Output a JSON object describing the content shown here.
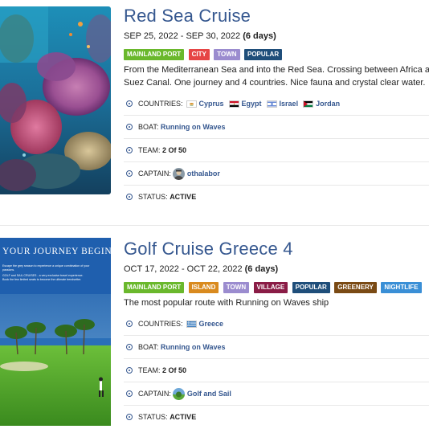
{
  "cruises": [
    {
      "title": "Red Sea Cruise",
      "dates": "SEP 25, 2022 - SEP 30, 2022",
      "duration": "(6 days)",
      "tags": [
        {
          "label": "MAINLAND PORT",
          "color": "#6ab82c"
        },
        {
          "label": "CITY",
          "color": "#e64545"
        },
        {
          "label": "TOWN",
          "color": "#9b8ccf"
        },
        {
          "label": "POPULAR",
          "color": "#1f4e7a"
        }
      ],
      "description_lines": [
        "From the Mediterranean Sea and into the Red Sea. Crossing between Africa and",
        "Suez Canal. One journey and 4 countries. Nice fauna and crystal clear water."
      ],
      "countries_label": "COUNTRIES:",
      "countries": [
        "Cyprus",
        "Egypt",
        "Israel",
        "Jordan"
      ],
      "boat_label": "BOAT:",
      "boat": "Running on Waves",
      "team_label": "TEAM:",
      "team": "2 Of 50",
      "captain_label": "CAPTAIN:",
      "captain": "othalabor",
      "status_label": "STATUS:",
      "status": "ACTIVE"
    },
    {
      "title": "Golf Cruise Greece 4",
      "dates": "OCT 17, 2022 - OCT 22, 2022",
      "duration": "(6 days)",
      "tags": [
        {
          "label": "MAINLAND PORT",
          "color": "#6ab82c"
        },
        {
          "label": "ISLAND",
          "color": "#d98a1e"
        },
        {
          "label": "TOWN",
          "color": "#9b8ccf"
        },
        {
          "label": "VILLAGE",
          "color": "#8a1c46"
        },
        {
          "label": "POPULAR",
          "color": "#1f4e7a"
        },
        {
          "label": "GREENERY",
          "color": "#7a4a14"
        },
        {
          "label": "NIGHTLIFE",
          "color": "#3a8fd6"
        }
      ],
      "description_lines": [
        "The most popular route with Running on Waves ship"
      ],
      "countries_label": "COUNTRIES:",
      "countries": [
        "Greece"
      ],
      "boat_label": "BOAT:",
      "boat": "Running on Waves",
      "team_label": "TEAM:",
      "team": "2 Of 50",
      "captain_label": "CAPTAIN:",
      "captain": "Golf and Sail",
      "status_label": "STATUS:",
      "status": "ACTIVE",
      "poster": {
        "headline": "YOUR JOURNEY BEGINS ...",
        "line1": "Escape the grey season to experience a unique combination of your",
        "line2": "passions.",
        "line3": "GOLF and SAIL CRUISES - a very exclusive travel experience.",
        "line4": "Book the few limited seats to become the ultimate trendsetter."
      }
    }
  ]
}
